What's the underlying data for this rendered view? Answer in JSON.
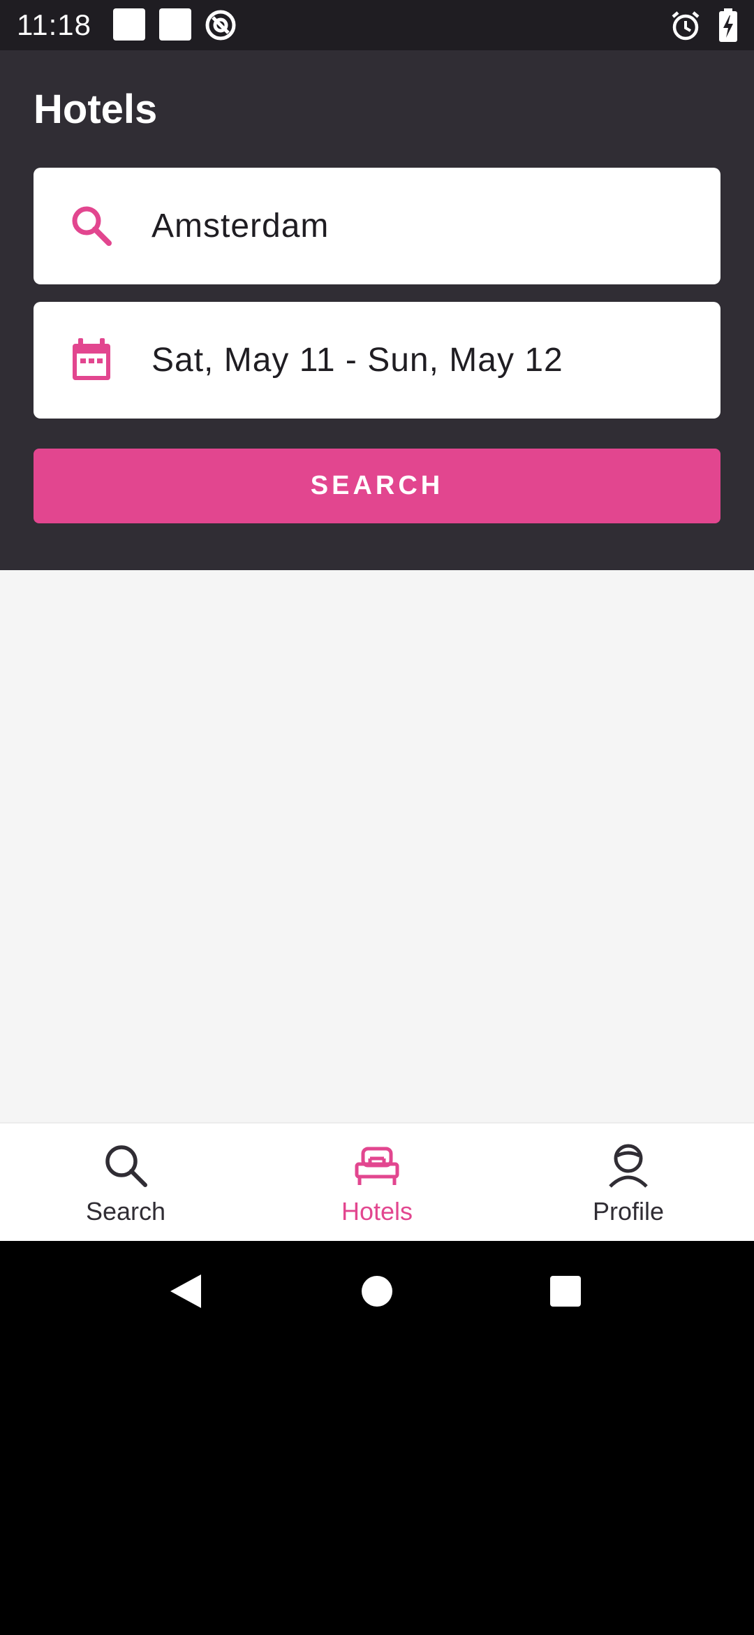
{
  "status_bar": {
    "time": "11:18",
    "left_icons": [
      "notification-square-icon",
      "notification-square-icon",
      "at-sign-icon"
    ],
    "right_icons": [
      "alarm-clock-icon",
      "battery-charging-icon"
    ]
  },
  "header": {
    "title": "Hotels",
    "location_field": {
      "icon": "search-icon",
      "value": "Amsterdam"
    },
    "dates_field": {
      "icon": "calendar-icon",
      "value": "Sat, May 11 - Sun, May 12"
    },
    "search_button_label": "SEARCH"
  },
  "bottom_nav": {
    "items": [
      {
        "label": "Search",
        "icon": "search-icon",
        "active": false
      },
      {
        "label": "Hotels",
        "icon": "bed-icon",
        "active": true
      },
      {
        "label": "Profile",
        "icon": "person-icon",
        "active": false
      }
    ]
  },
  "system_nav": {
    "buttons": [
      "back-icon",
      "home-icon",
      "recents-icon"
    ]
  },
  "colors": {
    "accent": "#e2468f",
    "header_bg": "#302d34",
    "status_bar_bg": "#1f1d22",
    "content_bg": "#f5f5f5"
  }
}
